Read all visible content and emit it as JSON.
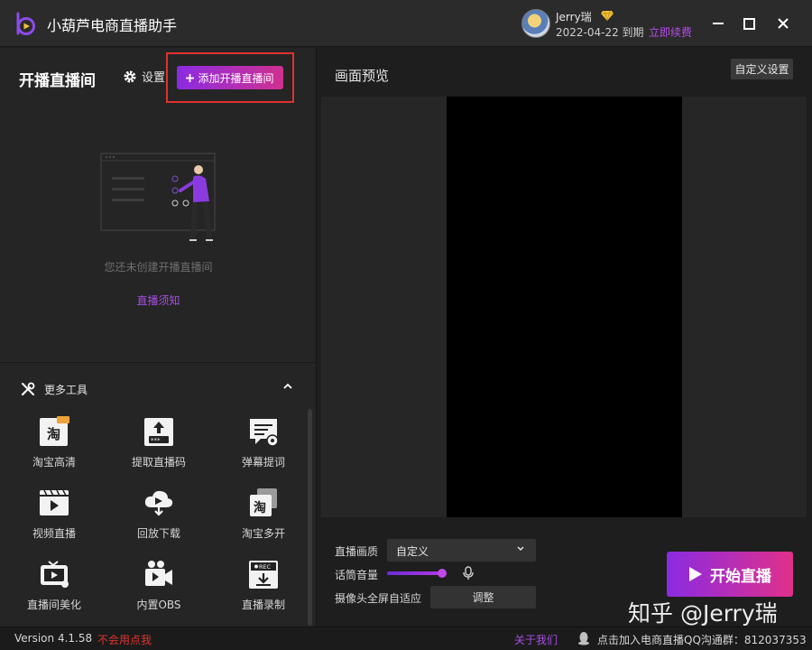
{
  "app": {
    "title": "小葫芦电商直播助手"
  },
  "user": {
    "name": "Jerry瑞",
    "expire_date": "2022-04-22 到期",
    "renew_label": "立即续费"
  },
  "left_panel": {
    "title": "开播直播间",
    "settings_label": "设置",
    "add_room_label": "添加开播直播间",
    "empty_text": "您还未创建开播直播间",
    "notice_link": "直播须知"
  },
  "tools": {
    "title": "更多工具",
    "items": [
      {
        "label": "淘宝高清",
        "icon": "taobao-hd-icon"
      },
      {
        "label": "提取直播码",
        "icon": "extract-code-icon"
      },
      {
        "label": "弹幕提词",
        "icon": "danmaku-prompt-icon"
      },
      {
        "label": "视频直播",
        "icon": "video-live-icon"
      },
      {
        "label": "回放下载",
        "icon": "replay-download-icon"
      },
      {
        "label": "淘宝多开",
        "icon": "taobao-multi-icon"
      },
      {
        "label": "直播间美化",
        "icon": "room-beautify-icon"
      },
      {
        "label": "内置OBS",
        "icon": "builtin-obs-icon"
      },
      {
        "label": "直播录制",
        "icon": "live-record-icon"
      }
    ]
  },
  "preview": {
    "title": "画面预览",
    "custom_settings_label": "自定义设置"
  },
  "controls": {
    "quality_label": "直播画质",
    "quality_value": "自定义",
    "volume_label": "话筒音量",
    "volume_level": 0.9,
    "camera_label": "摄像头全屏自适应",
    "adjust_label": "调整",
    "start_label": "开始直播"
  },
  "status": {
    "version": "Version 4.1.58",
    "help_link": "不会用点我",
    "about_link": "关于我们",
    "qq_text": "点击加入电商直播QQ沟通群：812037353"
  },
  "watermark": "知乎 @Jerry瑞",
  "colors": {
    "accent": "#8c2be2",
    "accent_end": "#d0308f",
    "highlight_border": "#e0322c"
  }
}
